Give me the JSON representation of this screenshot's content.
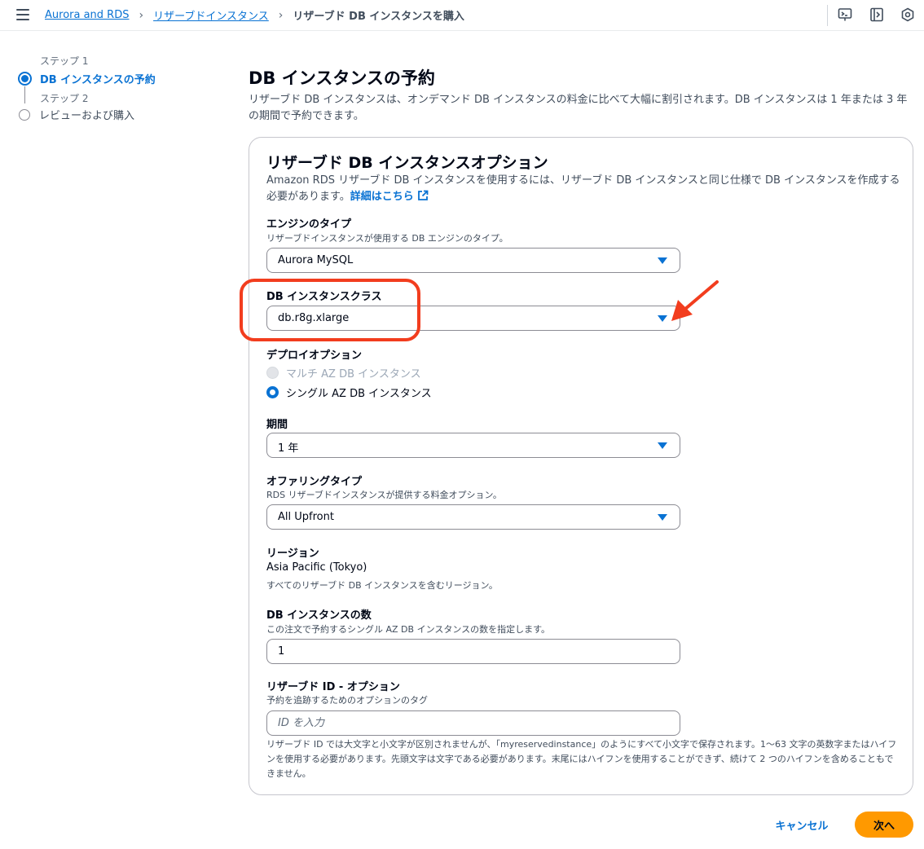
{
  "breadcrumb": {
    "items": [
      "Aurora and RDS",
      "リザーブドインスタンス"
    ],
    "current": "リザーブド DB インスタンスを購入"
  },
  "top_icons": [
    "cloudshell-icon",
    "notifications-panel-icon",
    "settings-hex-icon"
  ],
  "steps": [
    {
      "small": "ステップ 1",
      "label": "DB インスタンスの予約",
      "active": true
    },
    {
      "small": "ステップ 2",
      "label": "レビューおよび購入",
      "active": false
    }
  ],
  "page": {
    "title": "DB インスタンスの予約",
    "description": "リザーブド DB インスタンスは、オンデマンド DB インスタンスの料金に比べて大幅に割引されます。DB インスタンスは 1 年または 3 年の期間で予約できます。"
  },
  "card": {
    "title": "リザーブド DB インスタンスオプション",
    "description": "Amazon RDS リザーブド DB インスタンスを使用するには、リザーブド DB インスタンスと同じ仕様で DB インスタンスを作成する必要があります。",
    "link": "詳細はこちら"
  },
  "engine": {
    "label": "エンジンのタイプ",
    "hint": "リザーブドインスタンスが使用する DB エンジンのタイプ。",
    "value": "Aurora MySQL"
  },
  "instance_class": {
    "label": "DB インスタンスクラス",
    "value": "db.r8g.xlarge"
  },
  "deploy": {
    "label": "デプロイオプション",
    "options": [
      "マルチ AZ DB インスタンス",
      "シングル AZ DB インスタンス"
    ],
    "selected": "シングル AZ DB インスタンス"
  },
  "term": {
    "label": "期間",
    "value": "1 年"
  },
  "offering": {
    "label": "オファリングタイプ",
    "hint": "RDS リザーブドインスタンスが提供する料金オプション。",
    "value": "All Upfront"
  },
  "region": {
    "label": "リージョン",
    "value": "Asia Pacific (Tokyo)",
    "hint": "すべてのリザーブド DB インスタンスを含むリージョン。"
  },
  "count": {
    "label": "DB インスタンスの数",
    "hint": "この注文で予約するシングル AZ DB インスタンスの数を指定します。",
    "value": "1"
  },
  "reserved_id": {
    "label": "リザーブド ID - オプション",
    "hint": "予約を追跡するためのオプションのタグ",
    "placeholder": "ID を入力",
    "footnote": "リザーブド ID では大文字と小文字が区別されませんが、「myreservedinstance」のようにすべて小文字で保存されます。1〜63 文字の英数字またはハイフンを使用する必要があります。先頭文字は文字である必要があります。末尾にはハイフンを使用することができず、続けて 2 つのハイフンを含めることもできません。"
  },
  "actions": {
    "cancel": "キャンセル",
    "next": "次へ"
  },
  "colors": {
    "accent": "#0972d3",
    "primary_button": "#ff9900",
    "annotation": "#f23d1e"
  }
}
